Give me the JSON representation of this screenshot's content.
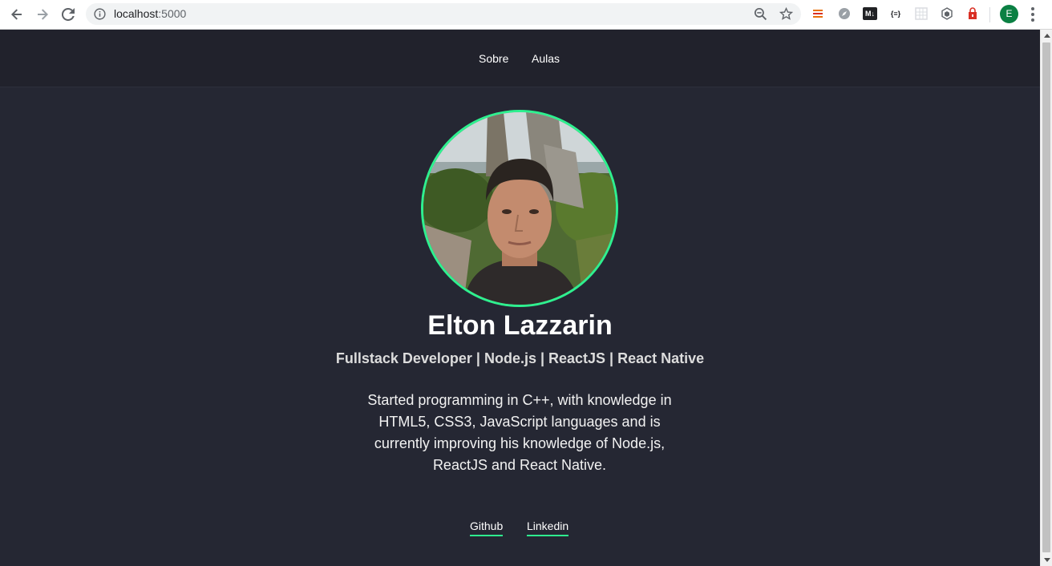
{
  "browser": {
    "url_host": "localhost",
    "url_port": ":5000",
    "profile_initial": "E",
    "extensions": [
      "bookmarks-extension-icon",
      "compass-extension-icon",
      "markdown-extension-icon",
      "json-extension-icon",
      "grid-extension-icon",
      "cube-extension-icon",
      "red-shield-extension-icon"
    ],
    "extension_labels": {
      "markdown": "M↓",
      "json": "{≡}"
    }
  },
  "nav": {
    "items": [
      {
        "label": "Sobre"
      },
      {
        "label": "Aulas"
      }
    ]
  },
  "profile": {
    "name": "Elton Lazzarin",
    "subtitle": "Fullstack Developer | Node.js | ReactJS | React Native",
    "bio": "Started programming in C++, with knowledge in HTML5, CSS3, JavaScript languages and is currently improving his knowledge of Node.js, ReactJS and React Native.",
    "avatar_alt": "profile photo"
  },
  "social": {
    "links": [
      {
        "label": "Github"
      },
      {
        "label": "Linkedin"
      }
    ]
  },
  "colors": {
    "page_bg": "#252733",
    "header_bg": "#21222c",
    "accent": "#2ef08f",
    "profile_green": "#0b8043"
  }
}
